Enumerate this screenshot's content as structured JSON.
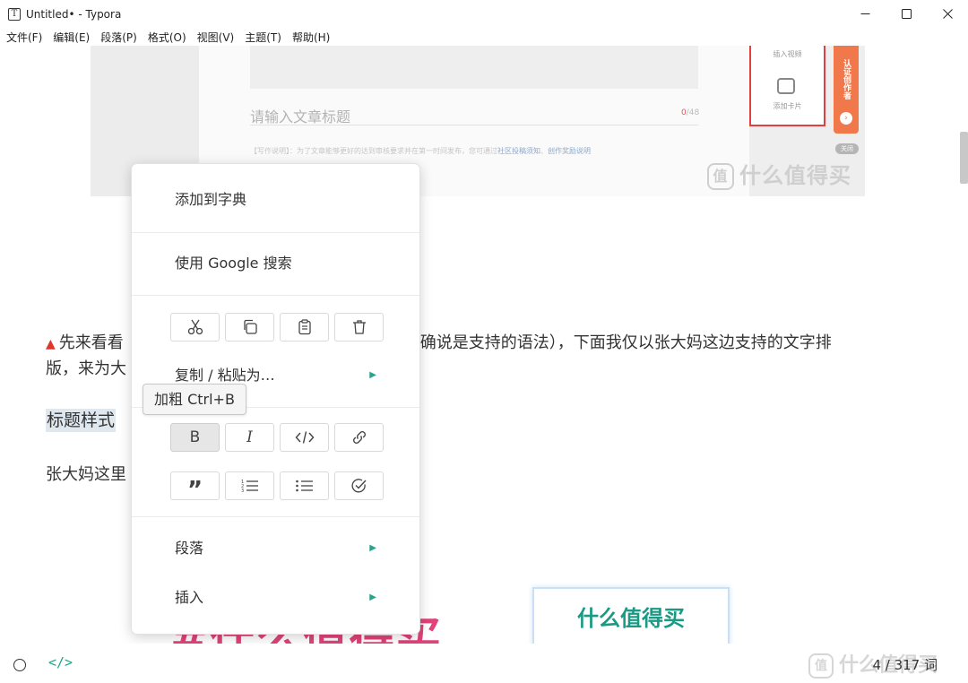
{
  "window": {
    "app_icon": "T",
    "title": "Untitled• - Typora"
  },
  "menubar": [
    "文件(F)",
    "编辑(E)",
    "段落(P)",
    "格式(O)",
    "视图(V)",
    "主题(T)",
    "帮助(H)"
  ],
  "embedded_image": {
    "title_placeholder": "请输入文章标题",
    "counter_prefix": "0",
    "counter_suffix": "/48",
    "desc_text": "【写作说明】：为了文章能够更好的达到审核要求并在第一时间发布，您可通过",
    "desc_link1": "社区投稿须知",
    "desc_link2": "创作奖励说明",
    "card_label_top": "插入视频",
    "card_label_bottom": "添加卡片",
    "orange_tab_text": "认证创作者",
    "close_label": "关闭",
    "watermark": "什么值得买",
    "watermark_badge": "值"
  },
  "document": {
    "para1_line1_start": "先来看看",
    "para1_line1_end": "准确说是支持的语法），下面我仅以张大妈这边支持的文字排",
    "para1_line2_start": "版，来为大",
    "heading_selected": "标题样式",
    "para2_start": "张大妈这里",
    "bottom_pink_text": "#什么值得买",
    "bottom_logo_text": "什么值得买"
  },
  "context_menu": {
    "add_to_dictionary": "添加到字典",
    "google_search": "使用 Google 搜索",
    "copy_paste_as": "复制 / 粘贴为…",
    "paragraph": "段落",
    "insert": "插入",
    "edit_tools": [
      "cut-icon",
      "copy-icon",
      "paste-icon",
      "delete-icon"
    ],
    "format_tools": [
      "bold-icon",
      "italic-icon",
      "code-icon",
      "link-icon"
    ],
    "block_tools": [
      "quote-icon",
      "ordered-list-icon",
      "unordered-list-icon",
      "task-list-icon"
    ]
  },
  "tooltip": "加粗 Ctrl+B",
  "statusbar": {
    "code_toggle": "</>",
    "word_count": "4 / 317 词",
    "watermark": "什么值得买",
    "watermark_badge": "值"
  },
  "colors": {
    "accent": "#2aa28c",
    "selection": "#dfe7ef",
    "pink": "#e0437a"
  }
}
